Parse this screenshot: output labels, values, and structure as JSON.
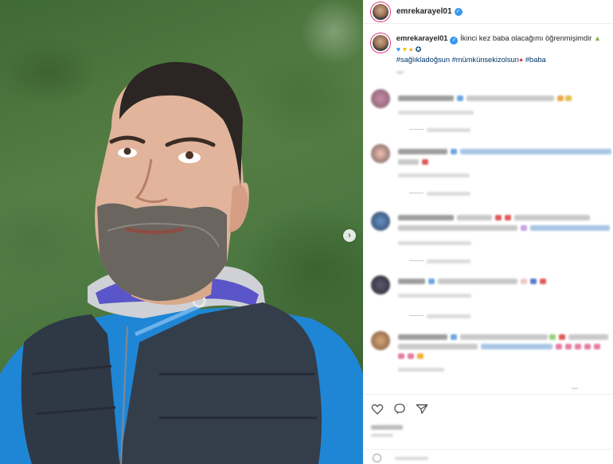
{
  "post": {
    "username": "emrekarayel01",
    "verified_mark": "✓",
    "carousel_next_glyph": "›",
    "caption": {
      "username": "emrekarayel01",
      "text": "İkinci kez baba olacağımı öğrenmişimdir",
      "emoji_line": [
        "♥",
        "♥",
        "💪",
        "✪"
      ],
      "hashtags": [
        "#sağlıkladoğsun",
        "#mümkünsekizolsun",
        "#baba"
      ],
      "end_emoji": "😍",
      "time": "4h"
    }
  },
  "colors": {
    "accent_blue": "#3897f0",
    "hashtag": "#00376b",
    "story_ring": "#d62976"
  },
  "icons": {
    "like": "heart-icon",
    "comment": "comment-icon",
    "share": "share-icon",
    "emoji": "smile-icon",
    "carousel": "chevron-right-icon"
  }
}
